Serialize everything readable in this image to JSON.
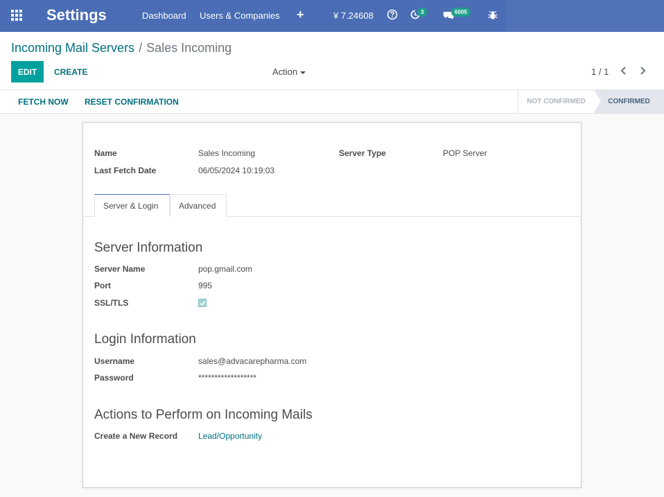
{
  "navbar": {
    "app_title": "Settings",
    "menu": [
      "Dashboard",
      "Users & Companies"
    ],
    "currency_value": "¥ 7.24608",
    "activity_count": "3",
    "messages_count": "6005",
    "icons": [
      "apps-grid-icon",
      "plus-icon",
      "help-icon",
      "activity-clock-icon",
      "chat-icon",
      "bug-icon"
    ]
  },
  "breadcrumb": {
    "parent": "Incoming Mail Servers",
    "separator": "/",
    "current": "Sales Incoming"
  },
  "toolbar": {
    "edit_label": "EDIT",
    "create_label": "CREATE",
    "action_label": "Action",
    "pager": "1 / 1"
  },
  "statusbar": {
    "fetch_now_label": "FETCH NOW",
    "reset_label": "RESET CONFIRMATION",
    "stages": [
      "NOT CONFIRMED",
      "CONFIRMED"
    ],
    "active_stage": "CONFIRMED"
  },
  "form": {
    "name_label": "Name",
    "name_value": "Sales Incoming",
    "last_fetch_label": "Last Fetch Date",
    "last_fetch_value": "06/05/2024 10:19:03",
    "server_type_label": "Server Type",
    "server_type_value": "POP Server",
    "tabs": [
      "Server & Login",
      "Advanced"
    ],
    "active_tab": "Server & Login",
    "server_info": {
      "title": "Server Information",
      "server_name_label": "Server Name",
      "server_name_value": "pop.gmail.com",
      "port_label": "Port",
      "port_value": "995",
      "ssl_label": "SSL/TLS",
      "ssl_checked": true
    },
    "login_info": {
      "title": "Login Information",
      "username_label": "Username",
      "username_value": "sales@advacarepharma.com",
      "password_label": "Password",
      "password_value": "******************"
    },
    "actions": {
      "title": "Actions to Perform on Incoming Mails",
      "create_record_label": "Create a New Record",
      "create_record_value": "Lead/Opportunity"
    }
  },
  "colors": {
    "navbar_bg": "#4a6db5",
    "primary_button": "#00a09d",
    "link": "#01707e"
  }
}
